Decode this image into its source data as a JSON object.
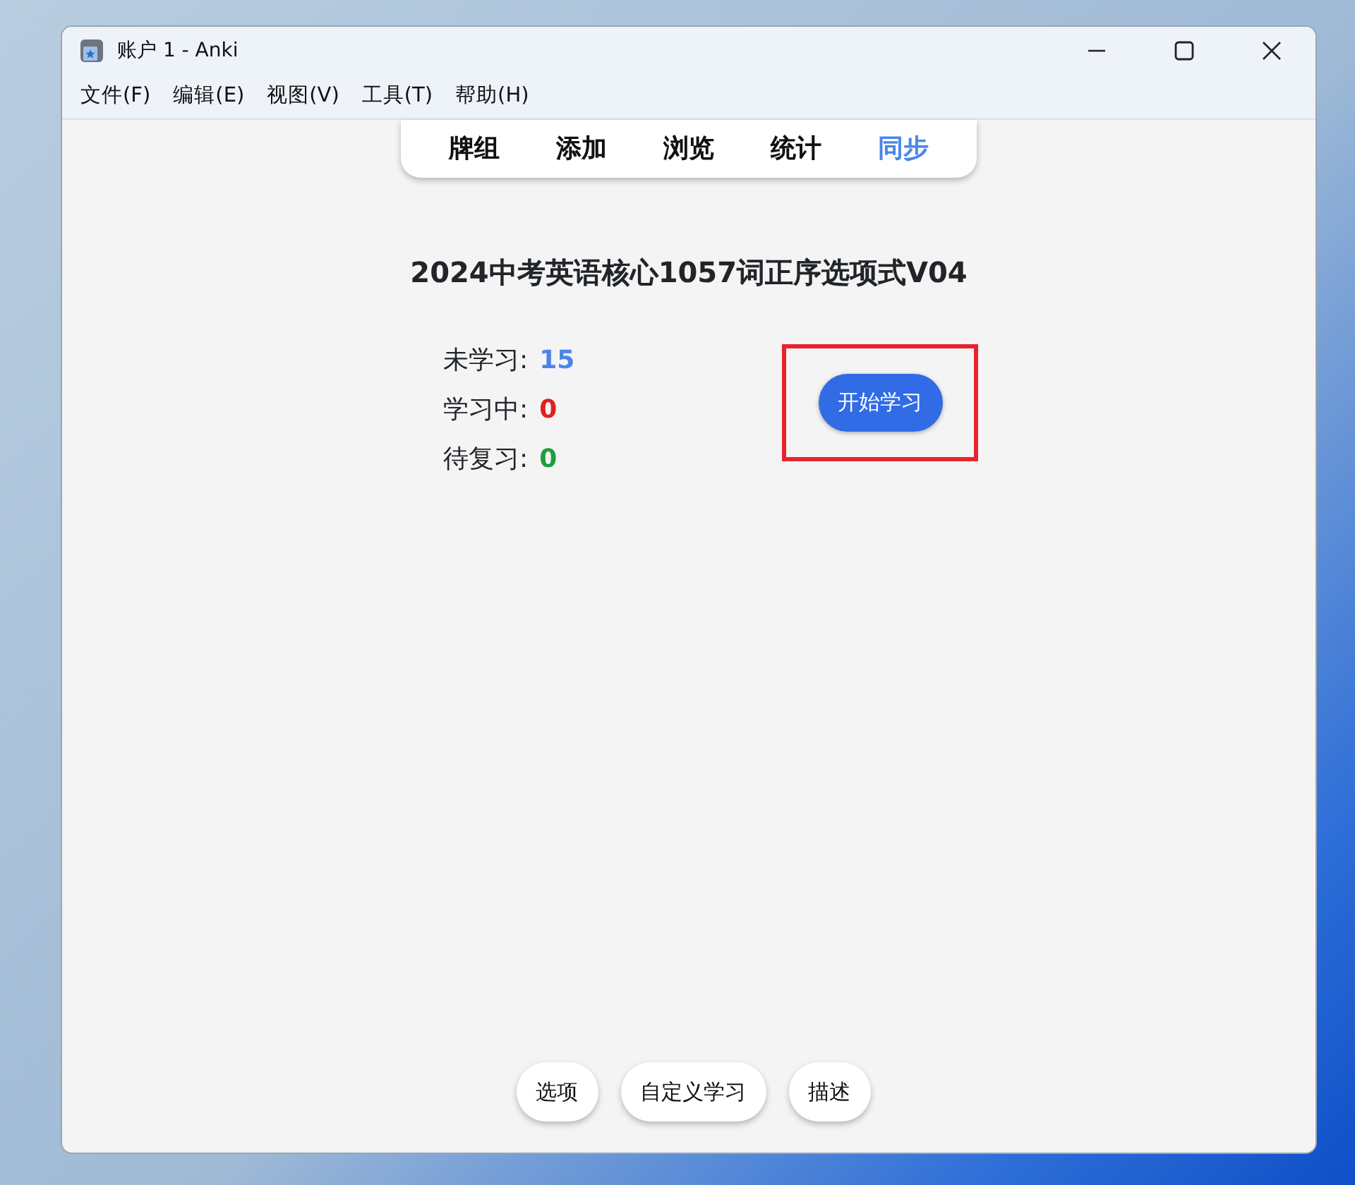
{
  "window": {
    "title": "账户 1 - Anki"
  },
  "menu": [
    "文件(F)",
    "编辑(E)",
    "视图(V)",
    "工具(T)",
    "帮助(H)"
  ],
  "toolbar": [
    {
      "label": "牌组",
      "highlighted": false
    },
    {
      "label": "添加",
      "highlighted": false
    },
    {
      "label": "浏览",
      "highlighted": false
    },
    {
      "label": "统计",
      "highlighted": false
    },
    {
      "label": "同步",
      "highlighted": true
    }
  ],
  "deck_title": "2024中考英语核心1057词正序选项式V04",
  "counts": [
    {
      "label": "未学习:",
      "value": "15",
      "color": "#4a86e8"
    },
    {
      "label": "学习中:",
      "value": "0",
      "color": "#e02020"
    },
    {
      "label": "待复习:",
      "value": "0",
      "color": "#1e9e40"
    }
  ],
  "start_button": {
    "label": "开始学习",
    "outlined": true
  },
  "bottom_buttons": [
    "选项",
    "自定义学习",
    "描述"
  ]
}
